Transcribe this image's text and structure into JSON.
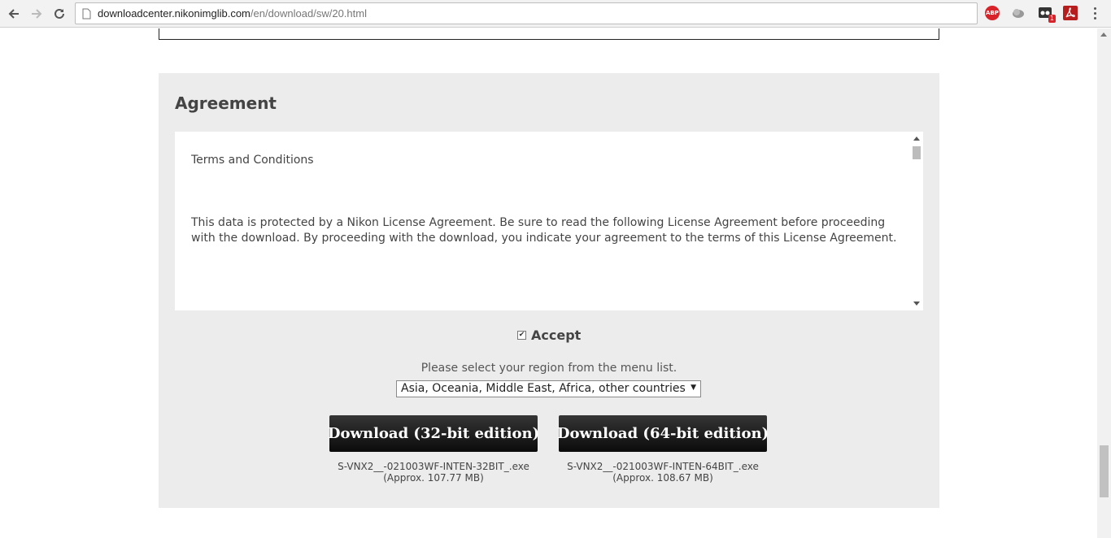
{
  "browser": {
    "url_host": "downloadcenter.nikonimglib.com",
    "url_path": "/en/download/sw/20.html",
    "extensions": [
      {
        "name": "adblock-plus-icon",
        "label": "ABP"
      },
      {
        "name": "cloud-extension-icon"
      },
      {
        "name": "mail-extension-icon",
        "badge": "1"
      },
      {
        "name": "acrobat-pdf-icon"
      }
    ]
  },
  "agreement": {
    "heading": "Agreement",
    "terms_title": "Terms and Conditions",
    "terms_body": "This data is protected by a Nikon License Agreement. Be sure to read the following License Agreement before proceeding with the download. By proceeding with the download, you indicate your agreement to the terms of this License Agreement.",
    "accept_checked": true,
    "accept_label": "Accept",
    "region_prompt": "Please select your region from the menu list.",
    "region_selected": "Asia, Oceania, Middle East, Africa, other countries"
  },
  "downloads": [
    {
      "label": "Download (32-bit edition)",
      "file": "S-VNX2__-021003WF-INTEN-32BIT_.exe",
      "size": "(Approx. 107.77 MB)"
    },
    {
      "label": "Download (64-bit edition)",
      "file": "S-VNX2__-021003WF-INTEN-64BIT_.exe",
      "size": "(Approx. 108.67 MB)"
    }
  ],
  "colors": {
    "panel_bg": "#ececec",
    "button_bg": "#1a1a1a",
    "abp_red": "#d9232a"
  }
}
